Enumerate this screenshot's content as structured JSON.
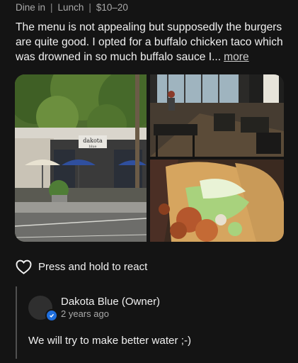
{
  "meta": {
    "tags": [
      "Dine in",
      "Lunch",
      "$10–20"
    ]
  },
  "review": {
    "text": "The menu is not appealing but supposedly the burgers are quite good.  I opted for a buffalo chicken taco which was drowned in so much buffalo sauce I...",
    "more_label": "more"
  },
  "photos": [
    {
      "name": "storefront-photo",
      "sign": "dakota blue"
    },
    {
      "name": "interior-photo"
    },
    {
      "name": "taco-photo"
    }
  ],
  "react": {
    "icon": "heart-outline-icon",
    "label": "Press and hold to react"
  },
  "owner_response": {
    "name": "Dakota Blue (Owner)",
    "time": "2 years ago",
    "badge_icon": "verified-check-icon",
    "badge_color": "#1f6fde",
    "text": "We will try to make better water ;-)"
  },
  "colors": {
    "background": "#141414",
    "text": "#f0f0f0",
    "muted": "#a9a9a9"
  }
}
